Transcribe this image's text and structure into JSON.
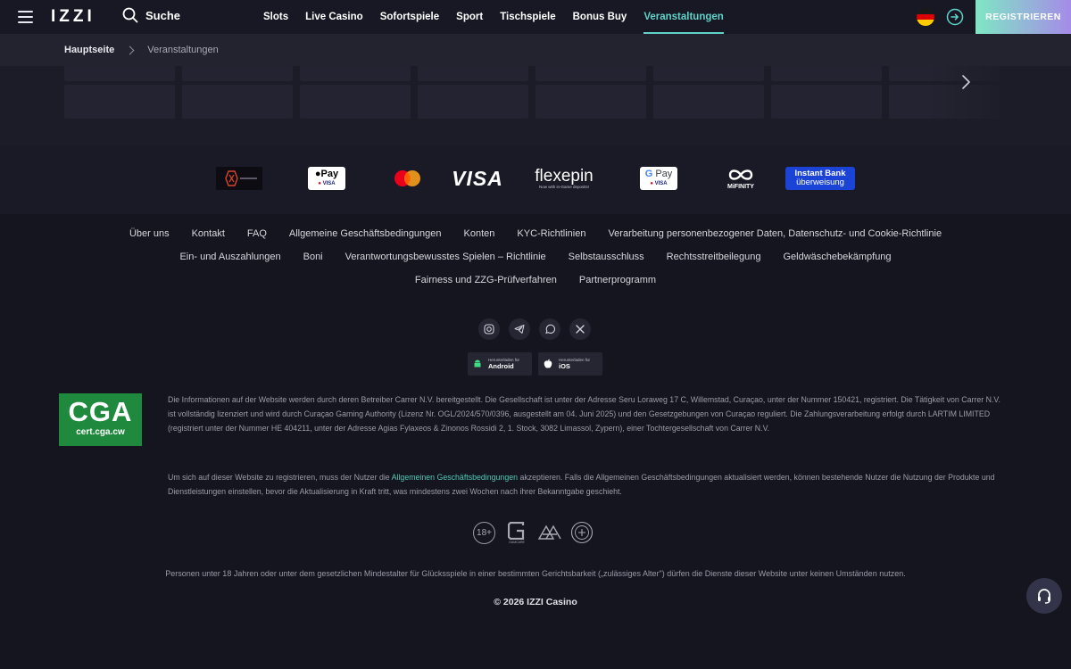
{
  "header": {
    "logo": "IZZI",
    "search_label": "Suche",
    "nav": [
      "Slots",
      "Live Casino",
      "Sofortspiele",
      "Sport",
      "Tischspiele",
      "Bonus Buy",
      "Veranstaltungen"
    ],
    "active_nav": "Veranstaltungen",
    "register_label": "REGISTRIEREN",
    "accent_color": "#5fd3c8"
  },
  "breadcrumb": {
    "home": "Hauptseite",
    "current": "Veranstaltungen"
  },
  "payments": {
    "apple_pay": "Pay",
    "apple_visa": "VISA",
    "visa": "VISA",
    "flexepin": "flexepin",
    "flexepin_tag": "Now with in-Game deposits!",
    "google_pay": "Pay",
    "google_visa": "VISA",
    "mifinity": "MiFINITY",
    "instant_bank_1": "Instant Bank",
    "instant_bank_2": "überweisung"
  },
  "footer_links": {
    "row1": [
      "Über uns",
      "Kontakt",
      "FAQ",
      "Allgemeine Geschäftsbedingungen",
      "Konten",
      "KYC-Richtlinien",
      "Verarbeitung personenbezogener Daten, Datenschutz- und Cookie-Richtlinie"
    ],
    "row2": [
      "Ein- und Auszahlungen",
      "Boni",
      "Verantwortungsbewusstes Spielen – Richtlinie",
      "Selbstausschluss",
      "Rechtsstreitbeilegung",
      "Geldwäschebekämpfung"
    ],
    "row3": [
      "Fairness und ZZG-Prüfverfahren",
      "Partnerprogramm"
    ]
  },
  "apps": {
    "android_small": "Herunterladen für",
    "android_big": "Android",
    "ios_small": "Herunterladen für",
    "ios_big": "iOS"
  },
  "cga": {
    "title": "CGA",
    "subtitle": "cert.cga.cw"
  },
  "legal": {
    "p1": "Die Informationen auf der Website werden durch deren Betreiber Carrer N.V. bereitgestellt. Die Gesellschaft ist unter der Adresse Seru Loraweg 17 C, Willemstad, Curaçao, unter der Nummer 150421, registriert. Die Tätigkeit von Carrer N.V. ist vollständig lizenziert und wird durch Curaçao Gaming Authority (Lizenz Nr. OGL/2024/570/0396, ausgestellt am 04. Juni 2025) und den Gesetzgebungen von Curaçao reguliert. Die Zahlungsverarbeitung erfolgt durch LARTIM LIMITED (registriert unter der Nummer HE 404211, unter der Adresse Agias Fylaxeos & Zinonos Rossidi 2, 1. Stock, 3082 Limassol, Zypern), einer Tochtergesellschaft von Carrer N.V.",
    "p2_before": "Um sich auf dieser Website zu registrieren, muss der Nutzer die ",
    "p2_link": "Allgemeinen Geschäftsbedingungen",
    "p2_after": " akzeptieren. Falls die Allgemeinen Geschäftsbedingungen aktualisiert werden, können bestehende Nutzer die Nutzung der Produkte und Dienstleistungen einstellen, bevor die Aktualisierung in Kraft tritt, was mindestens zwei Wochen nach ihrer Bekanntgabe geschieht."
  },
  "badges": {
    "age": "18+",
    "gamcare": "GAMCARE"
  },
  "minor_notice": "Personen unter 18 Jahren oder unter dem gesetzlichen Mindestalter für Glücksspiele in einer bestimmten Gerichtsbarkeit („zulässiges Alter\") dürfen die Dienste dieser Website unter keinen Umständen nutzen.",
  "copyright": "© 2026 IZZI Casino"
}
